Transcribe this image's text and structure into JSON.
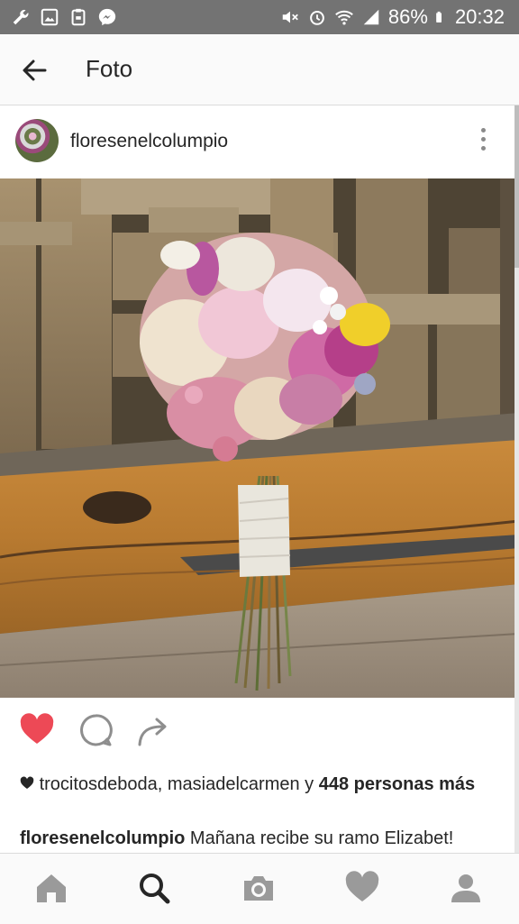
{
  "status_bar": {
    "battery": "86%",
    "time": "20:32",
    "left_icons": [
      "wrench-icon",
      "image-icon",
      "briefcase-icon",
      "messenger-icon"
    ],
    "right_icons": [
      "mute-icon",
      "alarm-icon",
      "wifi-icon",
      "signal-icon",
      "battery-icon"
    ]
  },
  "app_bar": {
    "title": "Foto"
  },
  "post": {
    "username": "floresenelcolumpio",
    "likes_users": "trocitosdeboda, masiadelcarmen",
    "likes_connector": " y ",
    "likes_count_text": "448 personas más",
    "caption_user": "floresenelcolumpio",
    "caption_text": " Mañana recibe su ramo Elizabet!"
  },
  "colors": {
    "status_bar": "#737373",
    "heart_liked": "#ed4956",
    "icon_gray": "#9a9a9a",
    "text": "#262626"
  },
  "bottom_nav": [
    "home-icon",
    "search-icon",
    "camera-icon",
    "heart-icon",
    "profile-icon"
  ]
}
